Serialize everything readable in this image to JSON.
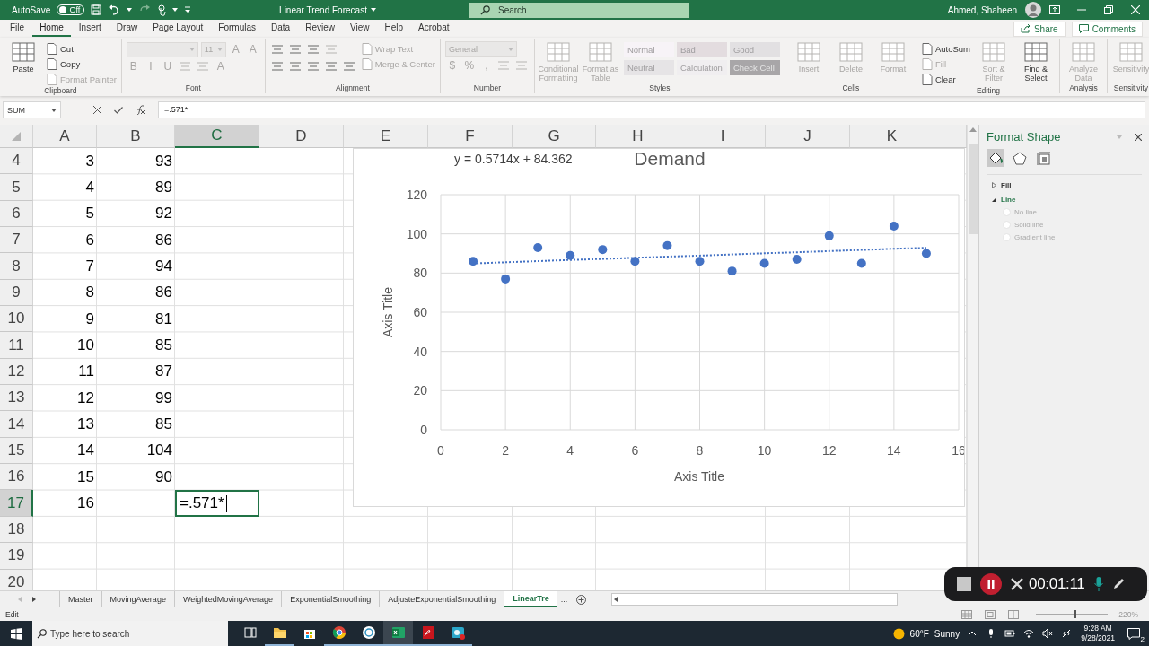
{
  "title_bar": {
    "autosave": {
      "label": "AutoSave",
      "state": "Off",
      "on": false
    },
    "title": "Linear Trend Forecast",
    "search": {
      "placeholder": "Search"
    },
    "user": "Ahmed, Shaheen"
  },
  "ribbon_tabs": [
    {
      "label": "File",
      "selected": false
    },
    {
      "label": "Home",
      "selected": true
    },
    {
      "label": "Insert",
      "selected": false
    },
    {
      "label": "Draw",
      "selected": false
    },
    {
      "label": "Page Layout",
      "selected": false
    },
    {
      "label": "Formulas",
      "selected": false
    },
    {
      "label": "Data",
      "selected": false
    },
    {
      "label": "Review",
      "selected": false
    },
    {
      "label": "View",
      "selected": false
    },
    {
      "label": "Help",
      "selected": false
    },
    {
      "label": "Acrobat",
      "selected": false
    }
  ],
  "share_button": "Share",
  "comments_button": "Comments",
  "ribbon_groups": [
    {
      "name": "Clipboard",
      "columns": [
        [
          [
            {
              "kind": "large",
              "label": "Paste",
              "disabled": false
            }
          ]
        ],
        [
          [
            {
              "kind": "small",
              "label": "Cut",
              "disabled": false
            }
          ],
          [
            {
              "kind": "small",
              "label": "Copy",
              "disabled": false
            }
          ],
          [
            {
              "kind": "small",
              "label": "Format Painter",
              "disabled": true
            }
          ]
        ]
      ]
    },
    {
      "name": "Font",
      "columns": [
        [
          [
            {
              "kind": "field",
              "disabled": true
            },
            {
              "kind": "field",
              "value": "11",
              "disabled": true
            },
            {
              "kind": "glyph",
              "label": "A",
              "disabled": true
            },
            {
              "kind": "glyph",
              "label": "A",
              "disabled": true
            }
          ],
          [
            {
              "kind": "glyph",
              "label": "B",
              "disabled": true
            },
            {
              "kind": "glyph",
              "label": "I",
              "disabled": true
            },
            {
              "kind": "glyph",
              "label": "U",
              "disabled": true
            },
            {
              "kind": "tool",
              "disabled": true
            },
            {
              "kind": "tool",
              "disabled": true
            },
            {
              "kind": "glyph",
              "label": "A",
              "disabled": true
            }
          ]
        ]
      ]
    },
    {
      "name": "Alignment",
      "columns": [
        [
          [
            {
              "kind": "tool",
              "disabled": false
            },
            {
              "kind": "tool",
              "disabled": false
            },
            {
              "kind": "tool",
              "disabled": false
            },
            {
              "kind": "tool",
              "disabled": true
            }
          ],
          [
            {
              "kind": "tool",
              "disabled": false
            },
            {
              "kind": "tool",
              "disabled": false
            },
            {
              "kind": "tool",
              "disabled": false
            },
            {
              "kind": "tool",
              "disabled": false
            },
            {
              "kind": "tool",
              "disabled": false
            }
          ]
        ],
        [
          [
            {
              "kind": "small",
              "label": "Wrap Text",
              "disabled": true
            }
          ],
          [
            {
              "kind": "small",
              "label": "Merge & Center",
              "disabled": true
            }
          ]
        ]
      ]
    },
    {
      "name": "Number",
      "columns": [
        [
          [
            {
              "kind": "field",
              "value": "General",
              "disabled": true
            }
          ],
          [
            {
              "kind": "glyph",
              "label": "$",
              "disabled": true
            },
            {
              "kind": "glyph",
              "label": "%",
              "disabled": true
            },
            {
              "kind": "glyph",
              "label": ",",
              "disabled": true
            },
            {
              "kind": "tool",
              "disabled": true
            },
            {
              "kind": "tool",
              "disabled": true
            }
          ]
        ]
      ]
    },
    {
      "name": "Styles",
      "columns": [
        [
          [
            {
              "kind": "large",
              "label": "Conditional Formatting",
              "disabled": true
            }
          ]
        ],
        [
          [
            {
              "kind": "large",
              "label": "Format as Table",
              "disabled": true
            }
          ]
        ],
        [
          [
            {
              "kind": "style",
              "label": "Normal",
              "color": "#f7f3f7",
              "disabled": true
            },
            {
              "kind": "style",
              "label": "Bad",
              "color": "#e3dcdf",
              "disabled": true
            },
            {
              "kind": "style",
              "label": "Good",
              "color": "#e2e0e2",
              "disabled": true
            }
          ],
          [
            {
              "kind": "style",
              "label": "Neutral",
              "color": "#e6e4e6",
              "disabled": true
            },
            {
              "kind": "style",
              "label": "Calculation",
              "color": "#f0eef0",
              "disabled": true
            },
            {
              "kind": "style",
              "label": "Check Cell",
              "color": "#a8a6a8",
              "disabled": true
            }
          ]
        ]
      ]
    },
    {
      "name": "Cells",
      "columns": [
        [
          [
            {
              "kind": "large",
              "label": "Insert",
              "disabled": true
            }
          ]
        ],
        [
          [
            {
              "kind": "large",
              "label": "Delete",
              "disabled": true
            }
          ]
        ],
        [
          [
            {
              "kind": "large",
              "label": "Format",
              "disabled": true
            }
          ]
        ]
      ]
    },
    {
      "name": "Editing",
      "columns": [
        [
          [
            {
              "kind": "small",
              "label": "AutoSum",
              "disabled": false
            }
          ],
          [
            {
              "kind": "small",
              "label": "Fill",
              "disabled": true
            }
          ],
          [
            {
              "kind": "small",
              "label": "Clear",
              "disabled": false
            }
          ]
        ],
        [
          [
            {
              "kind": "large",
              "label": "Sort & Filter",
              "disabled": true
            }
          ]
        ],
        [
          [
            {
              "kind": "large",
              "label": "Find & Select",
              "disabled": false
            }
          ]
        ]
      ]
    },
    {
      "name": "Analysis",
      "columns": [
        [
          [
            {
              "kind": "large",
              "label": "Analyze Data",
              "disabled": true
            }
          ]
        ]
      ]
    },
    {
      "name": "Sensitivity",
      "columns": [
        [
          [
            {
              "kind": "large",
              "label": "Sensitivity",
              "disabled": true
            }
          ]
        ]
      ]
    }
  ],
  "formula_bar": {
    "name_box": "SUM",
    "formula": "=.571*"
  },
  "sheet": {
    "columns": [
      {
        "label": "A",
        "selected": false
      },
      {
        "label": "B",
        "selected": false
      },
      {
        "label": "C",
        "selected": true
      },
      {
        "label": "D",
        "selected": false
      },
      {
        "label": "E",
        "selected": false
      },
      {
        "label": "F",
        "selected": false
      },
      {
        "label": "G",
        "selected": false
      },
      {
        "label": "H",
        "selected": false
      },
      {
        "label": "I",
        "selected": false
      },
      {
        "label": "J",
        "selected": false
      },
      {
        "label": "K",
        "selected": false
      }
    ],
    "rows": [
      {
        "header": "4",
        "selected": false,
        "cells": [
          {
            "value": "3",
            "editing": false
          },
          {
            "value": "93",
            "editing": false
          }
        ]
      },
      {
        "header": "5",
        "selected": false,
        "cells": [
          {
            "value": "4",
            "editing": false
          },
          {
            "value": "89",
            "editing": false
          }
        ]
      },
      {
        "header": "6",
        "selected": false,
        "cells": [
          {
            "value": "5",
            "editing": false
          },
          {
            "value": "92",
            "editing": false
          }
        ]
      },
      {
        "header": "7",
        "selected": false,
        "cells": [
          {
            "value": "6",
            "editing": false
          },
          {
            "value": "86",
            "editing": false
          }
        ]
      },
      {
        "header": "8",
        "selected": false,
        "cells": [
          {
            "value": "7",
            "editing": false
          },
          {
            "value": "94",
            "editing": false
          }
        ]
      },
      {
        "header": "9",
        "selected": false,
        "cells": [
          {
            "value": "8",
            "editing": false
          },
          {
            "value": "86",
            "editing": false
          }
        ]
      },
      {
        "header": "10",
        "selected": false,
        "cells": [
          {
            "value": "9",
            "editing": false
          },
          {
            "value": "81",
            "editing": false
          }
        ]
      },
      {
        "header": "11",
        "selected": false,
        "cells": [
          {
            "value": "10",
            "editing": false
          },
          {
            "value": "85",
            "editing": false
          }
        ]
      },
      {
        "header": "12",
        "selected": false,
        "cells": [
          {
            "value": "11",
            "editing": false
          },
          {
            "value": "87",
            "editing": false
          }
        ]
      },
      {
        "header": "13",
        "selected": false,
        "cells": [
          {
            "value": "12",
            "editing": false
          },
          {
            "value": "99",
            "editing": false
          }
        ]
      },
      {
        "header": "14",
        "selected": false,
        "cells": [
          {
            "value": "13",
            "editing": false
          },
          {
            "value": "85",
            "editing": false
          }
        ]
      },
      {
        "header": "15",
        "selected": false,
        "cells": [
          {
            "value": "14",
            "editing": false
          },
          {
            "value": "104",
            "editing": false
          }
        ]
      },
      {
        "header": "16",
        "selected": false,
        "cells": [
          {
            "value": "15",
            "editing": false
          },
          {
            "value": "90",
            "editing": false
          }
        ]
      },
      {
        "header": "17",
        "selected": true,
        "cells": [
          {
            "value": "16",
            "editing": false
          },
          {
            "editing": false
          },
          {
            "value": "=.571*",
            "editing": true
          }
        ]
      },
      {
        "header": "18",
        "selected": false,
        "cells": []
      },
      {
        "header": "19",
        "selected": false,
        "cells": []
      },
      {
        "header": "20",
        "selected": false,
        "cells": []
      }
    ],
    "chart_data": {
      "type": "scatter",
      "title": "Demand",
      "xlabel": "Axis Title",
      "ylabel": "Axis Title",
      "x": [
        1,
        2,
        3,
        4,
        5,
        6,
        7,
        8,
        9,
        10,
        11,
        12,
        13,
        14,
        15
      ],
      "series": [
        {
          "color": "#4472c4",
          "values": [
            86,
            77,
            93,
            89,
            92,
            86,
            94,
            86,
            81,
            85,
            87,
            99,
            85,
            104,
            90
          ]
        },
        {
          "type": "line",
          "line_style": "dotted",
          "color": "#4472c4",
          "values": [
            84.9,
            85.5,
            86.1,
            86.7,
            87.2,
            87.8,
            88.4,
            88.9,
            89.5,
            90.1,
            90.6,
            91.2,
            91.8,
            92.4,
            92.9
          ]
        }
      ],
      "grid": true,
      "xlim": [
        0,
        16
      ],
      "ylim": [
        0,
        120
      ],
      "xticks": [
        0,
        2,
        4,
        6,
        8,
        10,
        12,
        14,
        16
      ],
      "yticks": [
        0,
        20,
        40,
        60,
        80,
        100,
        120
      ],
      "annotations": [
        {
          "text": "y = 0.5714x + 84.362"
        }
      ]
    }
  },
  "format_pane": {
    "title": "Format Shape",
    "tabs": [
      {
        "selected": true
      },
      {
        "selected": false
      },
      {
        "selected": false
      }
    ],
    "sections": [
      {
        "label": "Fill",
        "expanded": false
      },
      {
        "label": "Line",
        "expanded": true,
        "options": [
          {
            "label": "No line",
            "selected": false,
            "disabled": true
          },
          {
            "label": "Solid line",
            "selected": false,
            "disabled": true
          },
          {
            "label": "Gradient line",
            "selected": false,
            "disabled": true
          }
        ]
      }
    ]
  },
  "sheet_tabs": {
    "tabs": [
      {
        "label": "Master",
        "selected": false
      },
      {
        "label": "MovingAverage",
        "selected": false
      },
      {
        "label": "WeightedMovingAverage",
        "selected": false
      },
      {
        "label": "ExponentialSmoothing",
        "selected": false
      },
      {
        "label": "AdjusteExponentialSmoothing",
        "selected": false
      },
      {
        "label": "LinearTre",
        "selected": true
      }
    ],
    "overflow": "..."
  },
  "status_bar": {
    "mode": "Edit",
    "zoom": "220%",
    "zoom_slider": {
      "level": 0.55
    }
  },
  "taskbar": {
    "search": {
      "placeholder": "Type here to search"
    },
    "apps": [
      {
        "kind": "taskview",
        "running": false,
        "active": false
      },
      {
        "kind": "folder",
        "running": true,
        "active": false
      },
      {
        "kind": "store",
        "running": false,
        "active": false
      },
      {
        "kind": "browser",
        "running": true,
        "active": false
      },
      {
        "kind": "disc",
        "running": true,
        "active": false
      },
      {
        "kind": "sheet",
        "running": true,
        "active": true
      },
      {
        "kind": "pdf",
        "running": true,
        "active": false
      },
      {
        "kind": "camera",
        "running": true,
        "active": false
      }
    ],
    "weather": {
      "temperature": "60°F",
      "condition": "Sunny"
    },
    "time": "9:28 AM",
    "date": "9/28/2021",
    "notifications": "2"
  },
  "recorder": {
    "elapsed": "00:01:11"
  }
}
